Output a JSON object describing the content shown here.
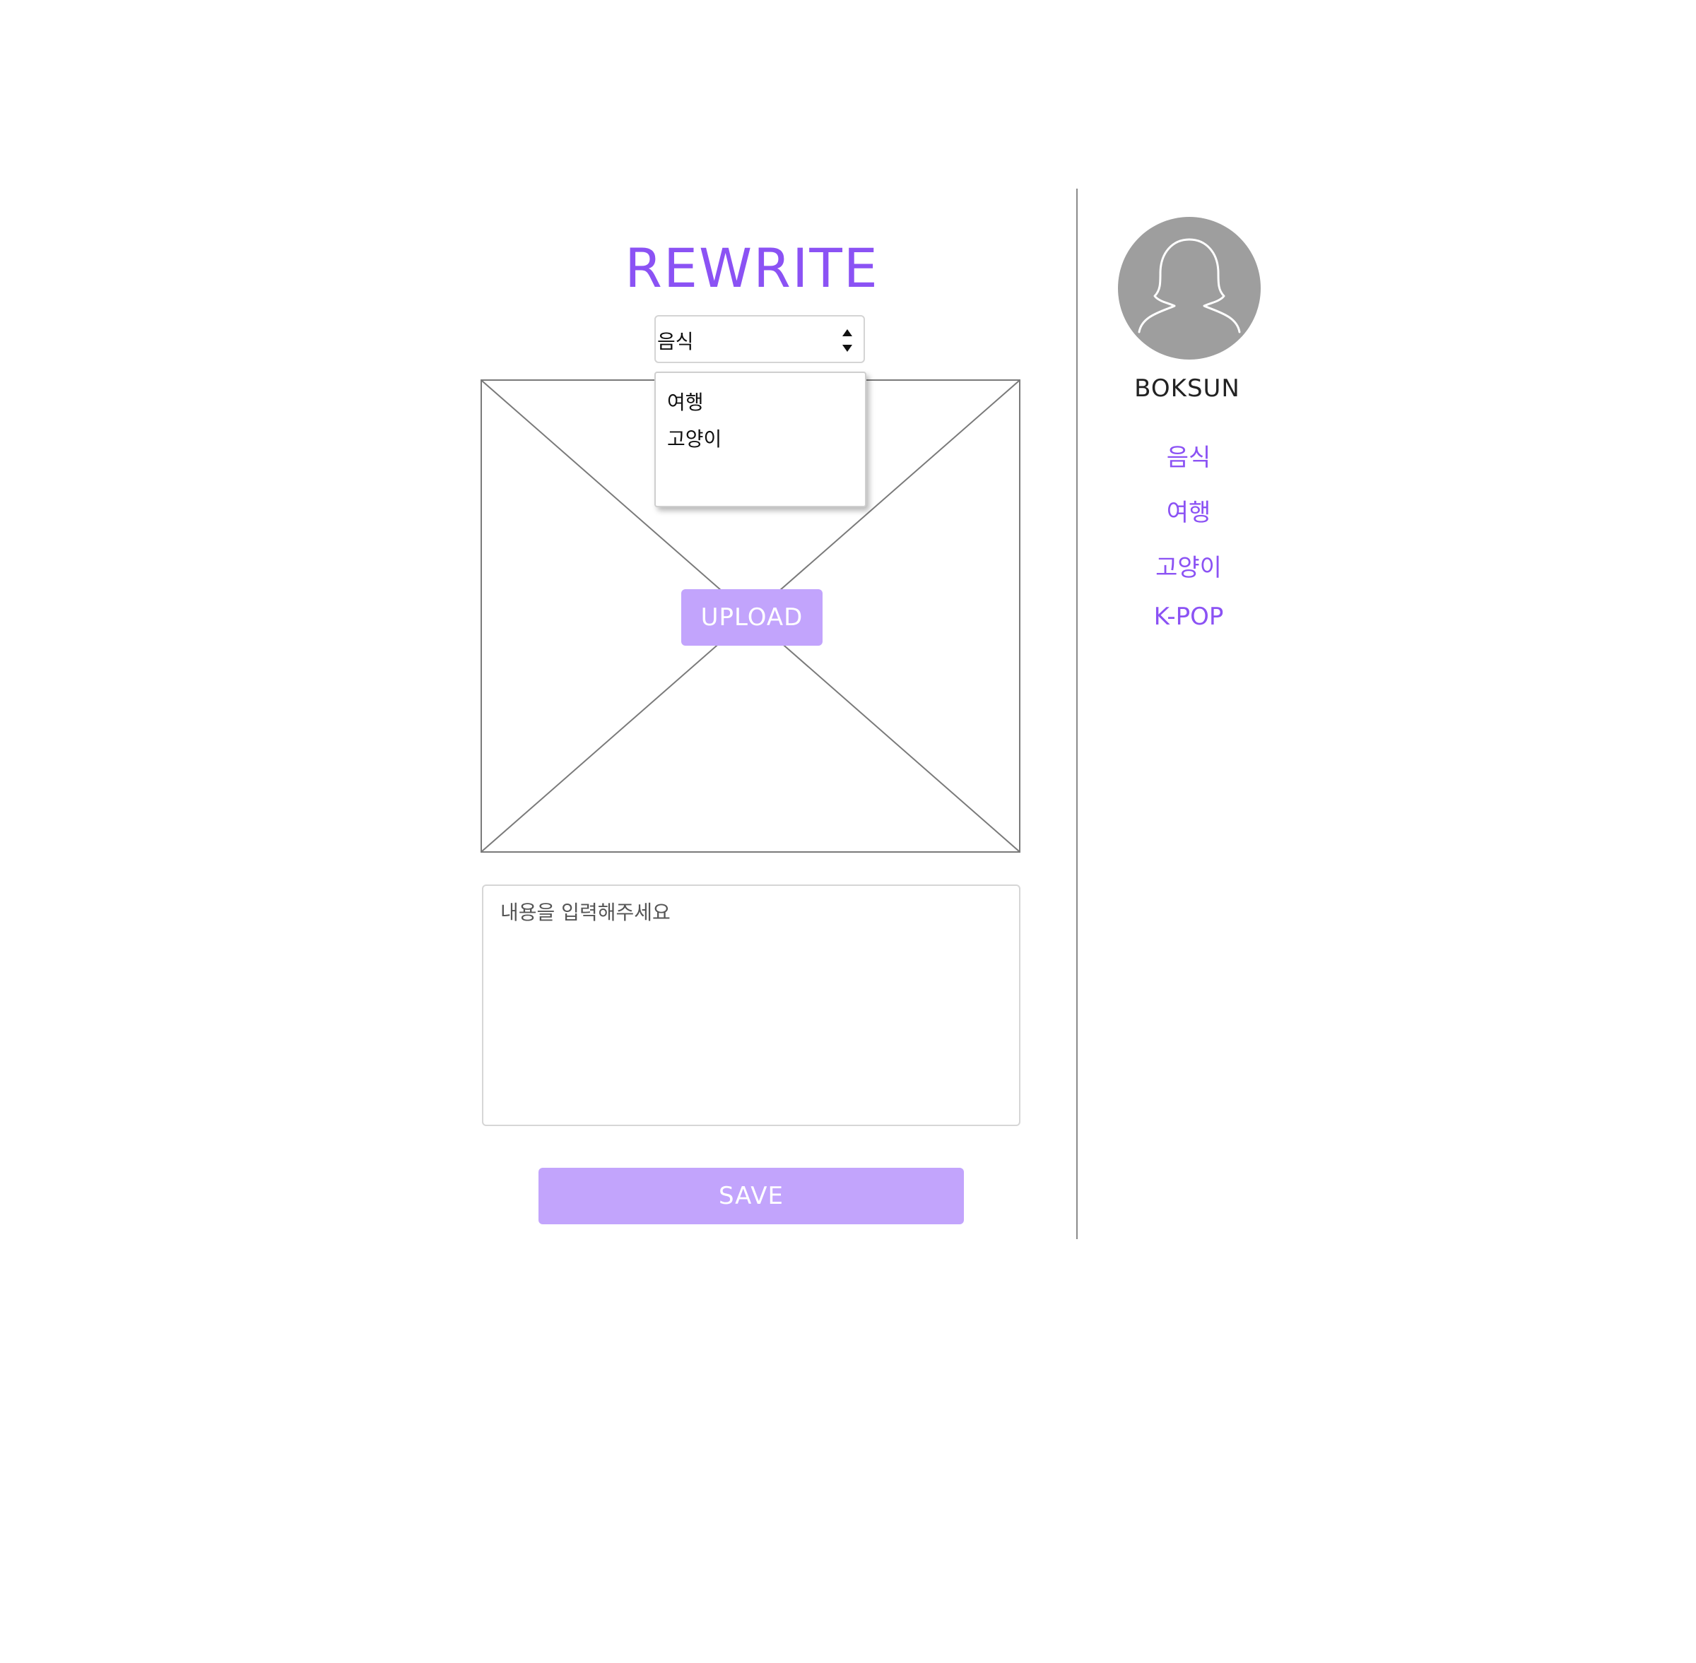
{
  "editor": {
    "title": "REWRITE",
    "category_select": {
      "selected": "음식",
      "options_visible": [
        "여행",
        "고양이"
      ]
    },
    "upload_label": "UPLOAD",
    "content_placeholder": "내용을 입력해주세요",
    "save_label": "SAVE"
  },
  "sidebar": {
    "profile_name": "BOKSUN",
    "categories": [
      "음식",
      "여행",
      "고양이",
      "K-POP"
    ]
  },
  "colors": {
    "accent": "#8b52f4",
    "button": "#c2a4fc",
    "avatar": "#9e9e9e",
    "divider": "#8a8a8a"
  },
  "icons": {
    "avatar": "female-user-silhouette-icon",
    "select_arrows": "sort-arrows-icon",
    "image_placeholder": "image-placeholder-cross"
  }
}
